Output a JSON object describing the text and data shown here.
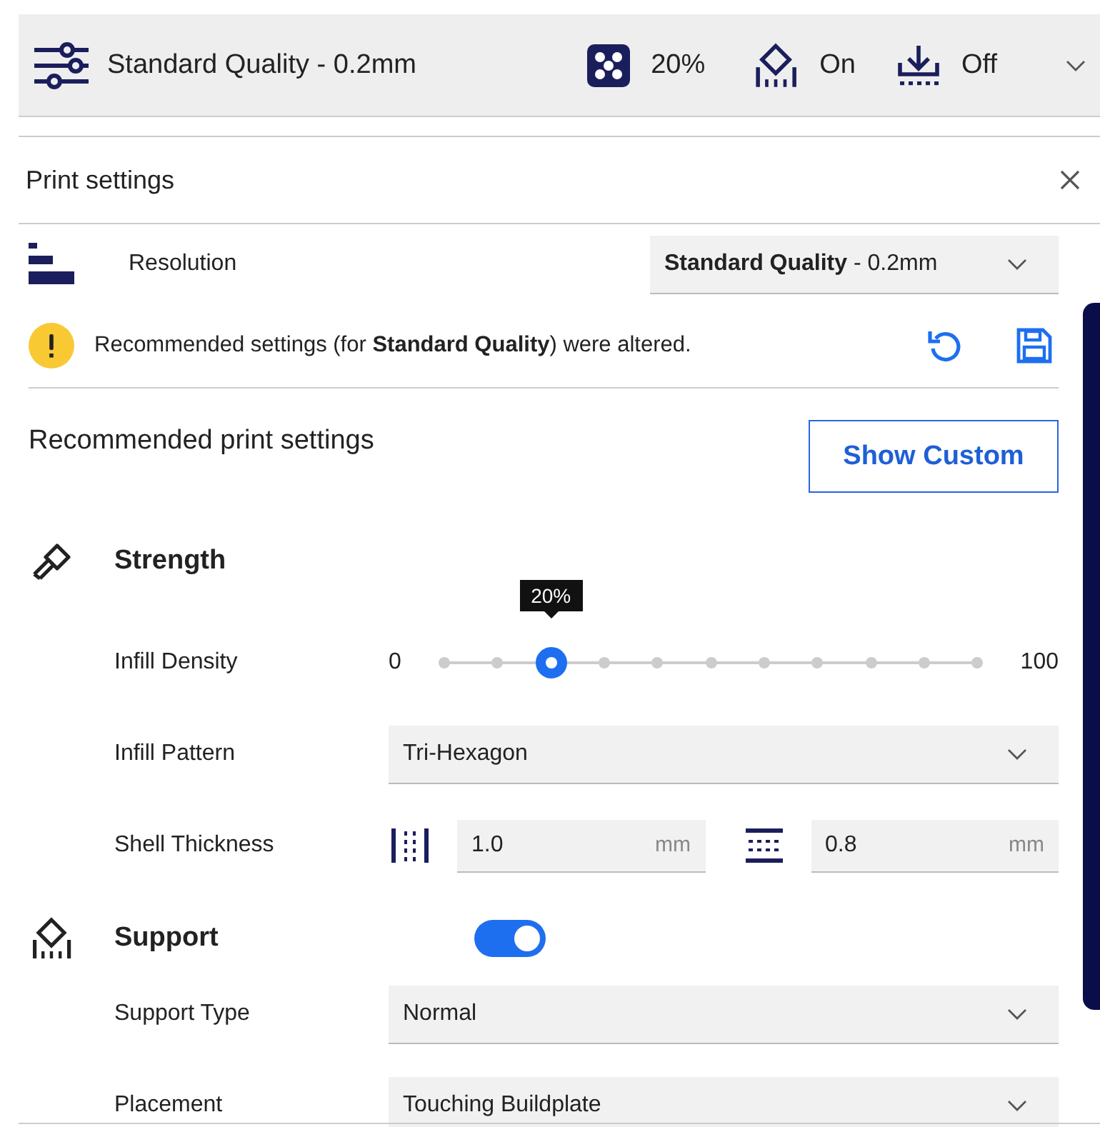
{
  "header": {
    "profile": "Standard Quality - 0.2mm",
    "infill": "20%",
    "support": "On",
    "adhesion": "Off"
  },
  "panel": {
    "title": "Print settings"
  },
  "resolution": {
    "label": "Resolution",
    "value": "**Standard Quality** - 0.2mm"
  },
  "notice": {
    "text": "Recommended settings (for **Standard Quality**) were altered."
  },
  "recommended": {
    "title": "Recommended print settings",
    "button": "Show Custom"
  },
  "sections": [
    {
      "title": "Strength",
      "rows": [
        {
          "kind": "slider",
          "label": "Infill Density",
          "min": "0",
          "max": "100",
          "tooltip": "20%",
          "level": 0.2
        },
        {
          "kind": "dropdown",
          "label": "Infill Pattern",
          "value": "Tri-Hexagon"
        },
        {
          "kind": "pair",
          "label": "Shell Thickness",
          "fields": [
            {
              "value": "1.0",
              "unit": "mm"
            },
            {
              "value": "0.8",
              "unit": "mm"
            }
          ]
        }
      ]
    },
    {
      "title": "Support",
      "on": true,
      "rows": [
        {
          "kind": "dropdown",
          "label": "Support Type",
          "value": "Normal"
        },
        {
          "kind": "dropdown",
          "label": "Placement",
          "value": "Touching Buildplate"
        }
      ]
    }
  ]
}
